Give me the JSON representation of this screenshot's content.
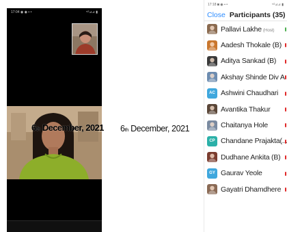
{
  "left_phone": {
    "status_time": "17:04 ◉ ◉ ▪ •",
    "status_right": "⁵ᴳ⊿⊿ ▮"
  },
  "overlay_date": {
    "day": "6",
    "suffix": "th",
    "rest": " December, 2021"
  },
  "caption_date": {
    "day": "6",
    "suffix": "th",
    "rest": " December, 2021"
  },
  "right_phone": {
    "status_time": "17:18 ◙ ◉ ▪ •",
    "status_right": "⁵ᴳ⊿⊿ ▮",
    "close_label": "Close",
    "title": "Participants (35)",
    "participants": [
      {
        "name": "Pallavi Lakhe",
        "tag": "(Host)",
        "avatar": "photo",
        "color": "#8a6a4f"
      },
      {
        "name": "Aadesh Thokale (B)",
        "tag": "",
        "avatar": "photo",
        "color": "#c9772e"
      },
      {
        "name": "Aditya Sankad (B)",
        "tag": "",
        "avatar": "photo",
        "color": "#3a3a3a"
      },
      {
        "name": "Akshay Shinde Div A",
        "tag": "",
        "avatar": "photo",
        "color": "#6d8cb0"
      },
      {
        "name": "Ashwini Chaudhari",
        "tag": "",
        "avatar": "AC",
        "color": "#3fa7dd"
      },
      {
        "name": "Avantika Thakur",
        "tag": "",
        "avatar": "photo",
        "color": "#5a4638"
      },
      {
        "name": "Chaitanya Hole",
        "tag": "",
        "avatar": "photo",
        "color": "#7a8aa0"
      },
      {
        "name": "Chandane Prajakta(...",
        "tag": "",
        "avatar": "CP",
        "color": "#2bb0a8"
      },
      {
        "name": "Dudhane Ankita (B)",
        "tag": "",
        "avatar": "photo",
        "color": "#7b3d2f"
      },
      {
        "name": "Gaurav Yeole",
        "tag": "",
        "avatar": "GY",
        "color": "#3fa7dd"
      },
      {
        "name": "Gayatri Dhamdhere",
        "tag": "",
        "avatar": "photo",
        "color": "#8a6a55"
      }
    ]
  },
  "colors": {
    "accent": "#2d8cff",
    "mic_muted": "#e02828"
  }
}
